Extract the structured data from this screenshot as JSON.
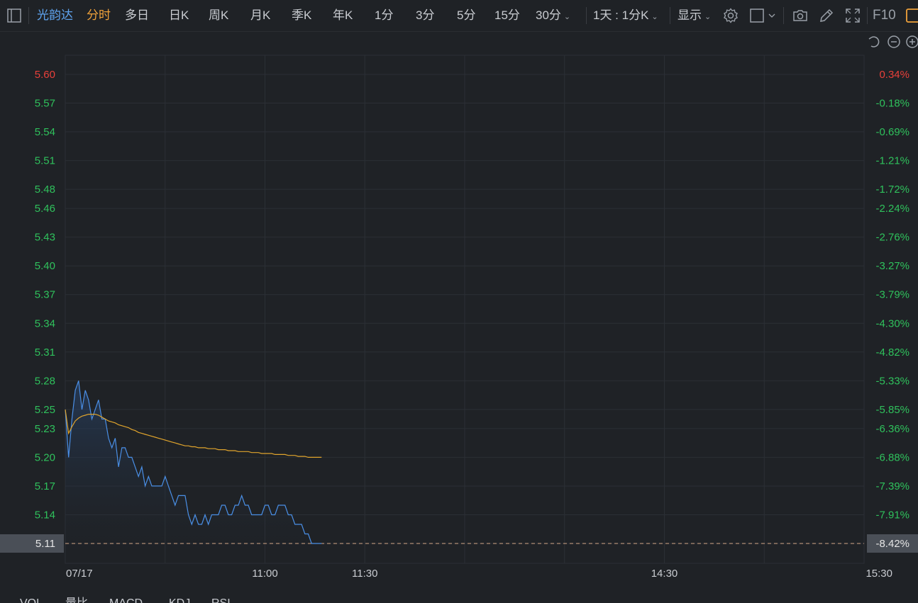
{
  "toolbar": {
    "stock_name": "光韵达",
    "periods": [
      "分时",
      "多日",
      "日K",
      "周K",
      "月K",
      "季K",
      "年K",
      "1分",
      "3分",
      "5分",
      "15分",
      "30分"
    ],
    "range_selector": "1天 : 1分K",
    "display_menu": "显示",
    "f10_label": "F10"
  },
  "chart_data": {
    "type": "line",
    "date_label": "07/17",
    "x_tick_labels": [
      "11:00",
      "11:30",
      "14:30",
      "15:30"
    ],
    "y_ticks": [
      5.6,
      5.57,
      5.54,
      5.51,
      5.48,
      5.46,
      5.43,
      5.4,
      5.37,
      5.34,
      5.31,
      5.28,
      5.25,
      5.23,
      5.2,
      5.17,
      5.14,
      5.11
    ],
    "y_tick_labels": [
      "5.60",
      "5.57",
      "5.54",
      "5.51",
      "5.48",
      "5.46",
      "5.43",
      "5.40",
      "5.37",
      "5.34",
      "5.31",
      "5.28",
      "5.25",
      "5.23",
      "5.20",
      "5.17",
      "5.14",
      "5.11"
    ],
    "pct_tick_labels": [
      "0.34%",
      "-0.18%",
      "-0.69%",
      "-1.21%",
      "-1.72%",
      "-2.24%",
      "-2.76%",
      "-3.27%",
      "-3.79%",
      "-4.30%",
      "-4.82%",
      "-5.33%",
      "-5.85%",
      "-6.36%",
      "-6.88%",
      "-7.39%",
      "-7.91%",
      "-8.42%"
    ],
    "ylim": [
      5.11,
      5.6
    ],
    "total_minutes": 240,
    "current_price": 5.11,
    "current_price_label": "5.11",
    "current_pct_label": "-8.42%",
    "series": [
      {
        "color": "#4a8fe6",
        "values": [
          5.25,
          5.2,
          5.24,
          5.27,
          5.28,
          5.25,
          5.27,
          5.26,
          5.24,
          5.25,
          5.26,
          5.24,
          5.24,
          5.22,
          5.21,
          5.22,
          5.19,
          5.21,
          5.21,
          5.2,
          5.2,
          5.19,
          5.18,
          5.19,
          5.17,
          5.18,
          5.17,
          5.17,
          5.17,
          5.17,
          5.18,
          5.17,
          5.16,
          5.15,
          5.16,
          5.16,
          5.16,
          5.14,
          5.13,
          5.14,
          5.13,
          5.13,
          5.14,
          5.13,
          5.14,
          5.14,
          5.14,
          5.15,
          5.15,
          5.14,
          5.14,
          5.15,
          5.15,
          5.16,
          5.15,
          5.15,
          5.14,
          5.14,
          5.14,
          5.14,
          5.15,
          5.15,
          5.14,
          5.14,
          5.15,
          5.15,
          5.15,
          5.14,
          5.14,
          5.13,
          5.13,
          5.13,
          5.12,
          5.12,
          5.11,
          5.11,
          5.11,
          5.11
        ]
      },
      {
        "color": "#e0a42c",
        "values": [
          5.25,
          5.225,
          5.232,
          5.238,
          5.241,
          5.243,
          5.244,
          5.245,
          5.245,
          5.245,
          5.244,
          5.242,
          5.24,
          5.238,
          5.237,
          5.236,
          5.234,
          5.233,
          5.232,
          5.231,
          5.229,
          5.228,
          5.226,
          5.225,
          5.224,
          5.223,
          5.222,
          5.221,
          5.22,
          5.219,
          5.218,
          5.217,
          5.216,
          5.215,
          5.214,
          5.213,
          5.212,
          5.212,
          5.211,
          5.211,
          5.21,
          5.21,
          5.21,
          5.209,
          5.209,
          5.209,
          5.208,
          5.208,
          5.208,
          5.207,
          5.207,
          5.207,
          5.206,
          5.206,
          5.206,
          5.206,
          5.205,
          5.205,
          5.205,
          5.204,
          5.204,
          5.204,
          5.204,
          5.203,
          5.203,
          5.203,
          5.203,
          5.202,
          5.202,
          5.202,
          5.201,
          5.201,
          5.201,
          5.2,
          5.2,
          5.2,
          5.2,
          5.2
        ]
      }
    ]
  },
  "bottom_tabs": [
    "VOL",
    "量比",
    "MACD",
    "KDJ",
    "RSI"
  ]
}
